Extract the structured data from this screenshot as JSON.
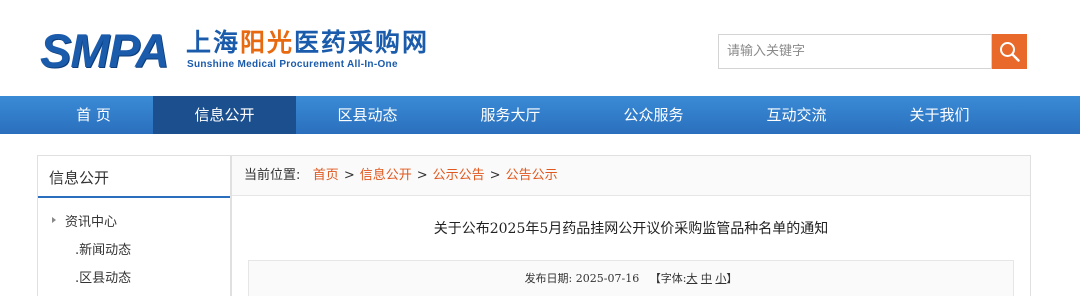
{
  "logo": {
    "abbr": "SMPA",
    "cn_prefix": "上海",
    "cn_accent": "阳光",
    "cn_suffix": "医药采购网",
    "en": "Sunshine Medical Procurement All-In-One"
  },
  "search": {
    "placeholder": "请输入关键字",
    "icon": "search-icon"
  },
  "nav": {
    "items": [
      {
        "label": "首 页"
      },
      {
        "label": "信息公开",
        "active": true
      },
      {
        "label": "区县动态"
      },
      {
        "label": "服务大厅"
      },
      {
        "label": "公众服务"
      },
      {
        "label": "互动交流"
      },
      {
        "label": "关于我们"
      }
    ]
  },
  "sidebar": {
    "title": "信息公开",
    "items": [
      {
        "label": "资讯中心"
      },
      {
        "label": ".新闻动态"
      },
      {
        "label": ".区县动态"
      }
    ]
  },
  "breadcrumb": {
    "prefix": "当前位置:",
    "items": [
      "首页",
      "信息公开",
      "公示公告",
      "公告公示"
    ],
    "separator": ">"
  },
  "article": {
    "title": "关于公布2025年5月药品挂网公开议价采购监管品种名单的通知",
    "date_label": "发布日期:",
    "date": "2025-07-16",
    "font_open": "【字体:",
    "font_sizes": [
      "大",
      "中",
      "小"
    ],
    "font_close": "】"
  },
  "colors": {
    "brand_blue": "#1b5bab",
    "accent_orange": "#e86a10",
    "nav_active": "#1c4f8e",
    "crumb_orange": "#e0581e"
  }
}
